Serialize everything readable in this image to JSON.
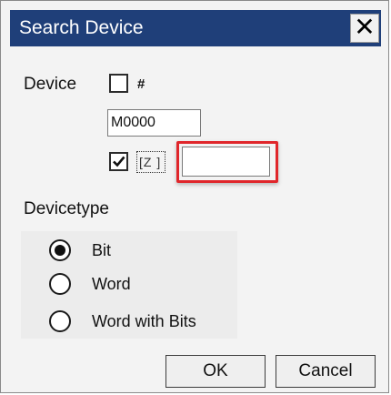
{
  "window": {
    "title": "Search Device",
    "close_glyph": "✕"
  },
  "device": {
    "label": "Device",
    "hash_checkbox_checked": false,
    "hash_label": "#",
    "address_value": "M0000",
    "z_checkbox_checked": true,
    "z_label": "[Z ]",
    "z_value": ""
  },
  "devicetype": {
    "label": "Devicetype",
    "options": [
      {
        "label": "Bit",
        "selected": true
      },
      {
        "label": "Word",
        "selected": false
      },
      {
        "label": "Word with Bits",
        "selected": false
      }
    ]
  },
  "buttons": {
    "ok_label": "OK",
    "cancel_label": "Cancel"
  },
  "colors": {
    "titlebar": "#1f3f79",
    "highlight": "#e0262b"
  }
}
